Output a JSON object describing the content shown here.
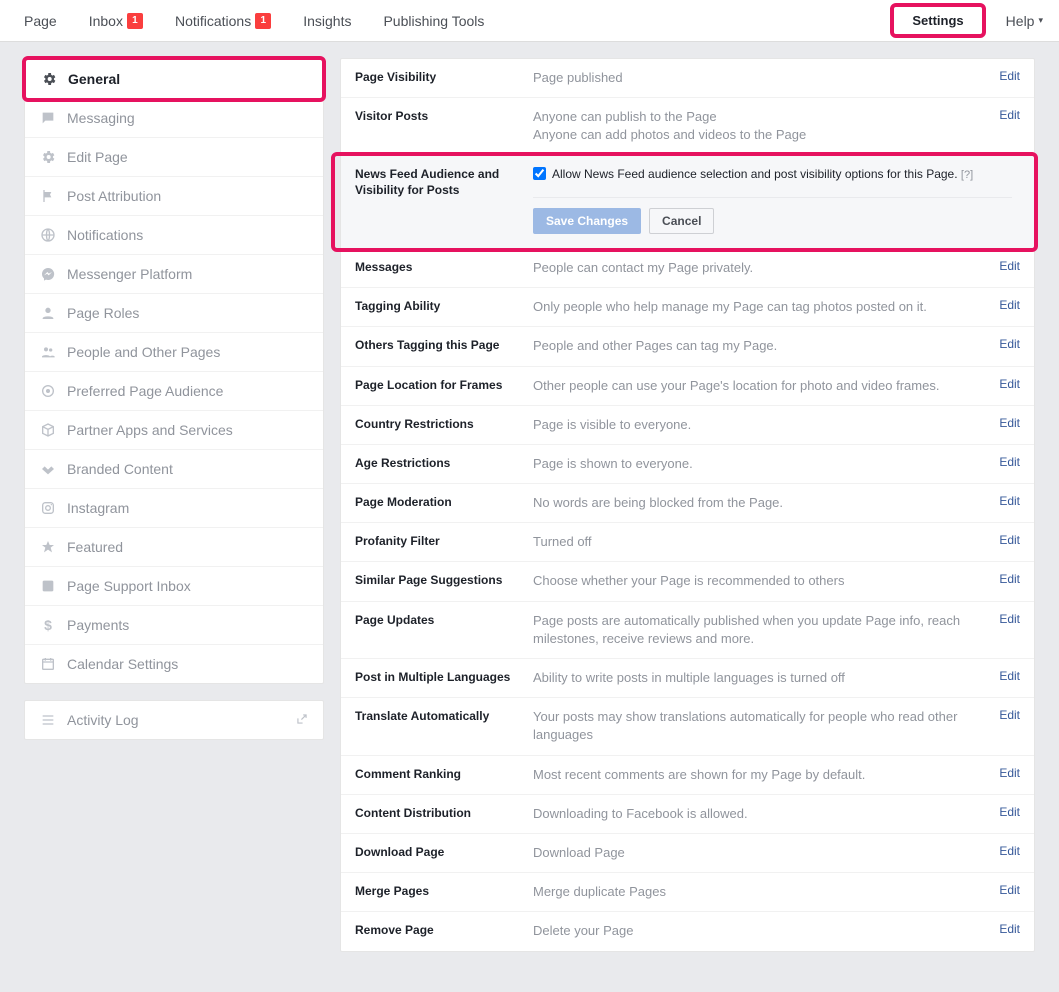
{
  "topnav": {
    "items": [
      {
        "label": "Page",
        "badge": null
      },
      {
        "label": "Inbox",
        "badge": "1"
      },
      {
        "label": "Notifications",
        "badge": "1"
      },
      {
        "label": "Insights",
        "badge": null
      },
      {
        "label": "Publishing Tools",
        "badge": null
      }
    ],
    "settings": "Settings",
    "help": "Help"
  },
  "sidebar": {
    "items": [
      {
        "label": "General",
        "icon": "gear"
      },
      {
        "label": "Messaging",
        "icon": "comment"
      },
      {
        "label": "Edit Page",
        "icon": "gear"
      },
      {
        "label": "Post Attribution",
        "icon": "flag"
      },
      {
        "label": "Notifications",
        "icon": "globe"
      },
      {
        "label": "Messenger Platform",
        "icon": "messenger"
      },
      {
        "label": "Page Roles",
        "icon": "person"
      },
      {
        "label": "People and Other Pages",
        "icon": "people"
      },
      {
        "label": "Preferred Page Audience",
        "icon": "target"
      },
      {
        "label": "Partner Apps and Services",
        "icon": "box"
      },
      {
        "label": "Branded Content",
        "icon": "handshake"
      },
      {
        "label": "Instagram",
        "icon": "instagram"
      },
      {
        "label": "Featured",
        "icon": "star"
      },
      {
        "label": "Page Support Inbox",
        "icon": "fbox"
      },
      {
        "label": "Payments",
        "icon": "dollar"
      },
      {
        "label": "Calendar Settings",
        "icon": "calendar"
      }
    ],
    "activity_log": "Activity Log"
  },
  "edit": "Edit",
  "rows": [
    {
      "label": "Page Visibility",
      "value": "Page published"
    },
    {
      "label": "Visitor Posts",
      "value": "Anyone can publish to the Page\nAnyone can add photos and videos to the Page"
    },
    {
      "label": "News Feed Audience and Visibility for Posts",
      "value": ""
    },
    {
      "label": "Messages",
      "value": "People can contact my Page privately."
    },
    {
      "label": "Tagging Ability",
      "value": "Only people who help manage my Page can tag photos posted on it."
    },
    {
      "label": "Others Tagging this Page",
      "value": "People and other Pages can tag my Page."
    },
    {
      "label": "Page Location for Frames",
      "value": "Other people can use your Page's location for photo and video frames."
    },
    {
      "label": "Country Restrictions",
      "value": "Page is visible to everyone."
    },
    {
      "label": "Age Restrictions",
      "value": "Page is shown to everyone."
    },
    {
      "label": "Page Moderation",
      "value": "No words are being blocked from the Page."
    },
    {
      "label": "Profanity Filter",
      "value": "Turned off"
    },
    {
      "label": "Similar Page Suggestions",
      "value": "Choose whether your Page is recommended to others"
    },
    {
      "label": "Page Updates",
      "value": "Page posts are automatically published when you update Page info, reach milestones, receive reviews and more."
    },
    {
      "label": "Post in Multiple Languages",
      "value": "Ability to write posts in multiple languages is turned off"
    },
    {
      "label": "Translate Automatically",
      "value": "Your posts may show translations automatically for people who read other languages"
    },
    {
      "label": "Comment Ranking",
      "value": "Most recent comments are shown for my Page by default."
    },
    {
      "label": "Content Distribution",
      "value": "Downloading to Facebook is allowed."
    },
    {
      "label": "Download Page",
      "value": "Download Page"
    },
    {
      "label": "Merge Pages",
      "value": "Merge duplicate Pages"
    },
    {
      "label": "Remove Page",
      "value": "Delete your Page"
    }
  ],
  "expanded": {
    "checkbox_label": "Allow News Feed audience selection and post visibility options for this Page.",
    "help": "[?]",
    "save": "Save Changes",
    "cancel": "Cancel"
  }
}
